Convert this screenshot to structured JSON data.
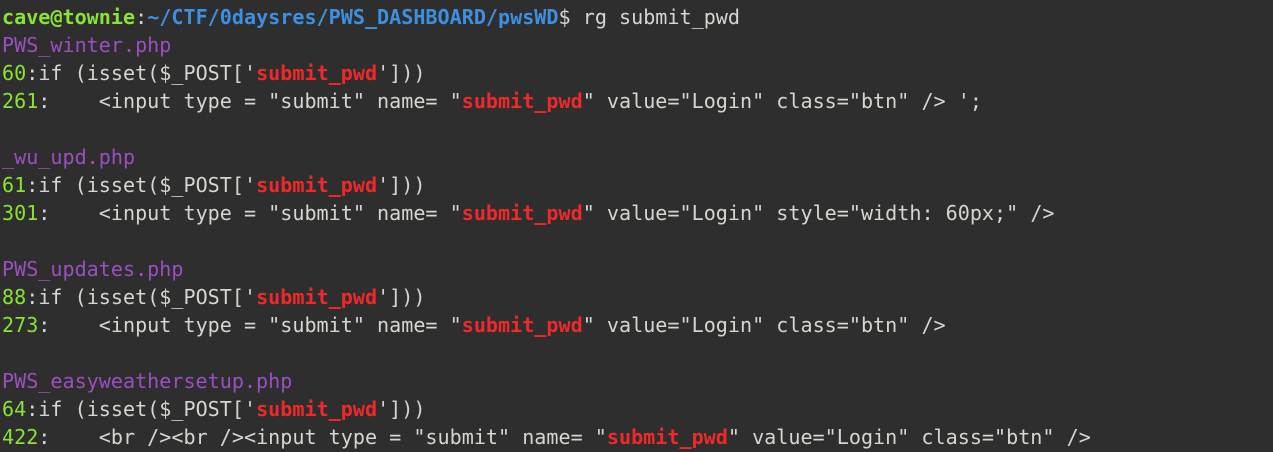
{
  "prompt": {
    "user_host": "cave@townie",
    "colon": ":",
    "path": "~/CTF/0daysres/PWS_DASHBOARD/pwsWD",
    "symbol": "$",
    "command": " rg submit_pwd"
  },
  "results": [
    {
      "file": "PWS_winter.php",
      "matches": [
        {
          "line": "60",
          "pre": "if (isset($_POST['",
          "match": "submit_pwd",
          "post": "']))"
        },
        {
          "line": "261",
          "pre": "    <input type = \"submit\" name= \"",
          "match": "submit_pwd",
          "post": "\" value=\"Login\" class=\"btn\" /> ';"
        }
      ]
    },
    {
      "file": "_wu_upd.php",
      "matches": [
        {
          "line": "61",
          "pre": "if (isset($_POST['",
          "match": "submit_pwd",
          "post": "']))"
        },
        {
          "line": "301",
          "pre": "    <input type = \"submit\" name= \"",
          "match": "submit_pwd",
          "post": "\" value=\"Login\" style=\"width: 60px;\" />"
        }
      ]
    },
    {
      "file": "PWS_updates.php",
      "matches": [
        {
          "line": "88",
          "pre": "if (isset($_POST['",
          "match": "submit_pwd",
          "post": "']))"
        },
        {
          "line": "273",
          "pre": "    <input type = \"submit\" name= \"",
          "match": "submit_pwd",
          "post": "\" value=\"Login\" class=\"btn\" />"
        }
      ]
    },
    {
      "file": "PWS_easyweathersetup.php",
      "matches": [
        {
          "line": "64",
          "pre": "if (isset($_POST['",
          "match": "submit_pwd",
          "post": "']))"
        },
        {
          "line": "422",
          "pre": "    <br /><br /><input type = \"submit\" name= \"",
          "match": "submit_pwd",
          "post": "\" value=\"Login\" class=\"btn\" />"
        }
      ]
    }
  ],
  "colors": {
    "background": "#2e2e2e",
    "foreground": "#d3d7cf",
    "prompt_user": "#8ae234",
    "prompt_path": "#3d8fe0",
    "file_name": "#9a4fbf",
    "line_number": "#8ae234",
    "match": "#ef2929"
  }
}
